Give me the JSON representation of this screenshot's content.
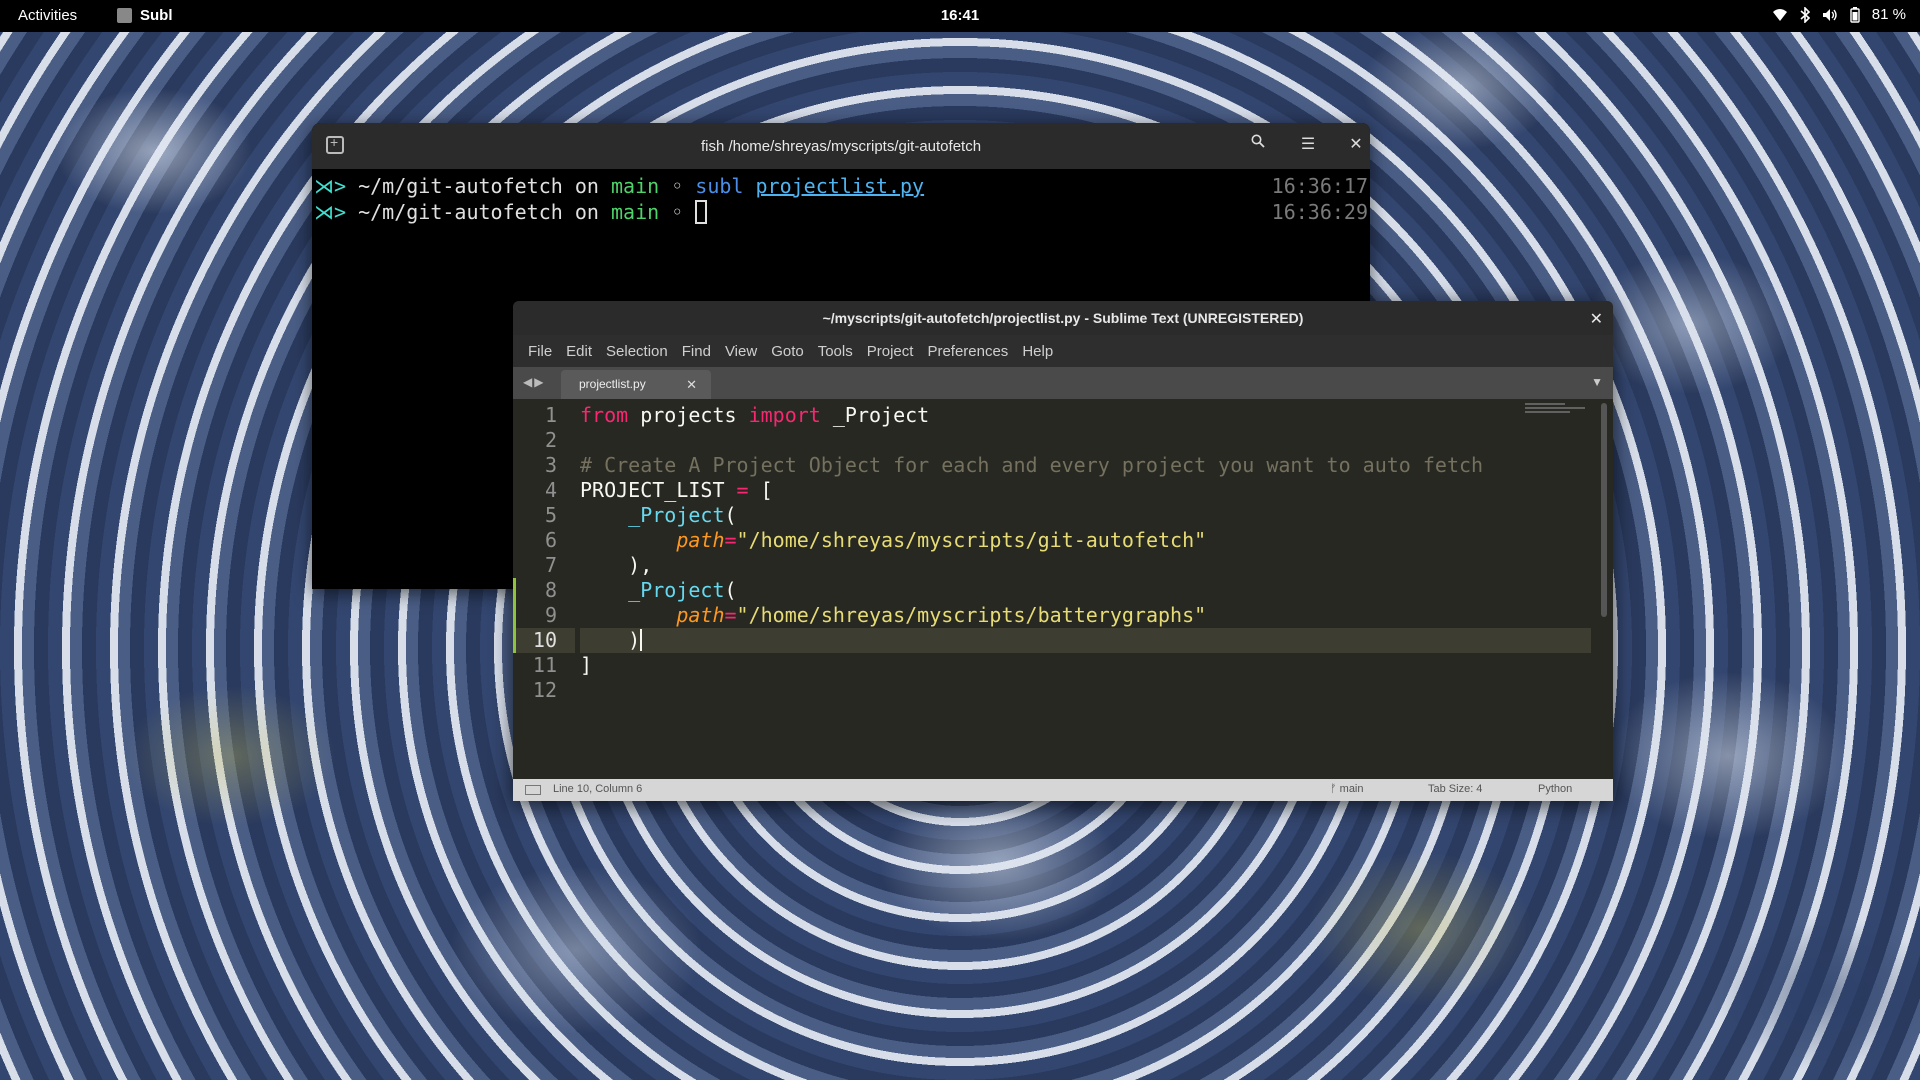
{
  "topbar": {
    "activities": "Activities",
    "app_name": "Subl",
    "clock": "16:41",
    "battery": "81 %",
    "icons": [
      "wifi-icon",
      "bluetooth-icon",
      "volume-icon",
      "battery-icon"
    ]
  },
  "terminal": {
    "title": "fish /home/shreyas/myscripts/git-autofetch",
    "lines": [
      {
        "prompt": "⋊>",
        "path": "~/m/git-autofetch",
        "on": "on",
        "branch": "main",
        "dot": "◦",
        "cmd": "subl",
        "arg": "projectlist.py",
        "time": "16:36:17"
      },
      {
        "prompt": "⋊>",
        "path": "~/m/git-autofetch",
        "on": "on",
        "branch": "main",
        "dot": "◦",
        "cmd": "",
        "arg": "",
        "time": "16:36:29"
      }
    ]
  },
  "sublime": {
    "title": "~/myscripts/git-autofetch/projectlist.py - Sublime Text (UNREGISTERED)",
    "menu": [
      "File",
      "Edit",
      "Selection",
      "Find",
      "View",
      "Goto",
      "Tools",
      "Project",
      "Preferences",
      "Help"
    ],
    "tab": {
      "label": "projectlist.py"
    },
    "line_numbers": [
      "1",
      "2",
      "3",
      "4",
      "5",
      "6",
      "7",
      "8",
      "9",
      "10",
      "11",
      "12"
    ],
    "active_line": 10,
    "code": {
      "l1_from": "from",
      "l1_mod": " projects ",
      "l1_import": "import",
      "l1_name": " _Project",
      "l3_comment": "# Create A Project Object for each and every project you want to auto fetch",
      "l4_name": "PROJECT_LIST ",
      "l4_eq": "=",
      "l4_bracket": " [",
      "l5_indent": "    ",
      "l5_fn": "_Project",
      "l5_paren": "(",
      "l6_indent": "        ",
      "l6_param": "path",
      "l6_eq": "=",
      "l6_str": "\"/home/shreyas/myscripts/git-autofetch\"",
      "l7_text": "    ),",
      "l8_indent": "    ",
      "l8_fn": "_Project",
      "l8_paren": "(",
      "l9_indent": "        ",
      "l9_param": "path",
      "l9_eq": "=",
      "l9_str": "\"/home/shreyas/myscripts/batterygraphs\"",
      "l10_text": "    )",
      "l11_text": "]"
    },
    "status": {
      "position": "Line 10, Column 6",
      "branch": "main",
      "tab_size": "Tab Size: 4",
      "syntax": "Python"
    }
  }
}
